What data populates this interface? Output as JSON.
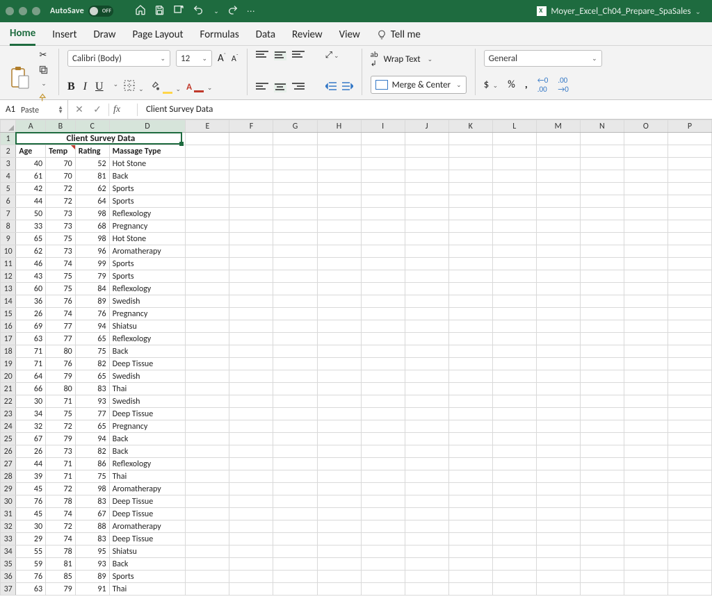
{
  "titlebar": {
    "autosave_label": "AutoSave",
    "autosave_state": "OFF",
    "filename": "Moyer_Excel_Ch04_Prepare_SpaSales"
  },
  "tabs": {
    "items": [
      "Home",
      "Insert",
      "Draw",
      "Page Layout",
      "Formulas",
      "Data",
      "Review",
      "View"
    ],
    "active": "Home",
    "tell_me": "Tell me"
  },
  "ribbon": {
    "paste_label": "Paste",
    "font_name": "Calibri (Body)",
    "font_size": "12",
    "wrap_text": "Wrap Text",
    "merge_center": "Merge & Center",
    "number_format": "General"
  },
  "formula_bar": {
    "cell_ref": "A1",
    "formula": "Client Survey Data"
  },
  "sheet": {
    "column_letters": [
      "A",
      "B",
      "C",
      "D",
      "E",
      "F",
      "G",
      "H",
      "I",
      "J",
      "K",
      "L",
      "M",
      "N",
      "O",
      "P"
    ],
    "merged_title": "Client Survey Data",
    "headers": [
      "Age",
      "Temp",
      "Rating",
      "Massage Type"
    ],
    "rows": [
      [
        40,
        70,
        52,
        "Hot Stone"
      ],
      [
        61,
        70,
        81,
        "Back"
      ],
      [
        42,
        72,
        62,
        "Sports"
      ],
      [
        44,
        72,
        64,
        "Sports"
      ],
      [
        50,
        73,
        98,
        "Reflexology"
      ],
      [
        33,
        73,
        68,
        "Pregnancy"
      ],
      [
        65,
        75,
        98,
        "Hot Stone"
      ],
      [
        62,
        73,
        96,
        "Aromatherapy"
      ],
      [
        46,
        74,
        99,
        "Sports"
      ],
      [
        43,
        75,
        79,
        "Sports"
      ],
      [
        60,
        75,
        84,
        "Reflexology"
      ],
      [
        36,
        76,
        89,
        "Swedish"
      ],
      [
        26,
        74,
        76,
        "Pregnancy"
      ],
      [
        69,
        77,
        94,
        "Shiatsu"
      ],
      [
        63,
        77,
        65,
        "Reflexology"
      ],
      [
        71,
        80,
        75,
        "Back"
      ],
      [
        71,
        76,
        82,
        "Deep Tissue"
      ],
      [
        64,
        79,
        65,
        "Swedish"
      ],
      [
        66,
        80,
        83,
        "Thai"
      ],
      [
        30,
        71,
        93,
        "Swedish"
      ],
      [
        34,
        75,
        77,
        "Deep Tissue"
      ],
      [
        32,
        72,
        65,
        "Pregnancy"
      ],
      [
        67,
        79,
        94,
        "Back"
      ],
      [
        26,
        73,
        82,
        "Back"
      ],
      [
        44,
        71,
        86,
        "Reflexology"
      ],
      [
        39,
        71,
        75,
        "Thai"
      ],
      [
        45,
        72,
        98,
        "Aromatherapy"
      ],
      [
        76,
        78,
        83,
        "Deep Tissue"
      ],
      [
        45,
        74,
        67,
        "Deep Tissue"
      ],
      [
        30,
        72,
        88,
        "Aromatherapy"
      ],
      [
        29,
        74,
        83,
        "Deep Tissue"
      ],
      [
        55,
        78,
        95,
        "Shiatsu"
      ],
      [
        59,
        81,
        93,
        "Back"
      ],
      [
        76,
        85,
        89,
        "Sports"
      ],
      [
        63,
        79,
        91,
        "Thai"
      ]
    ]
  }
}
